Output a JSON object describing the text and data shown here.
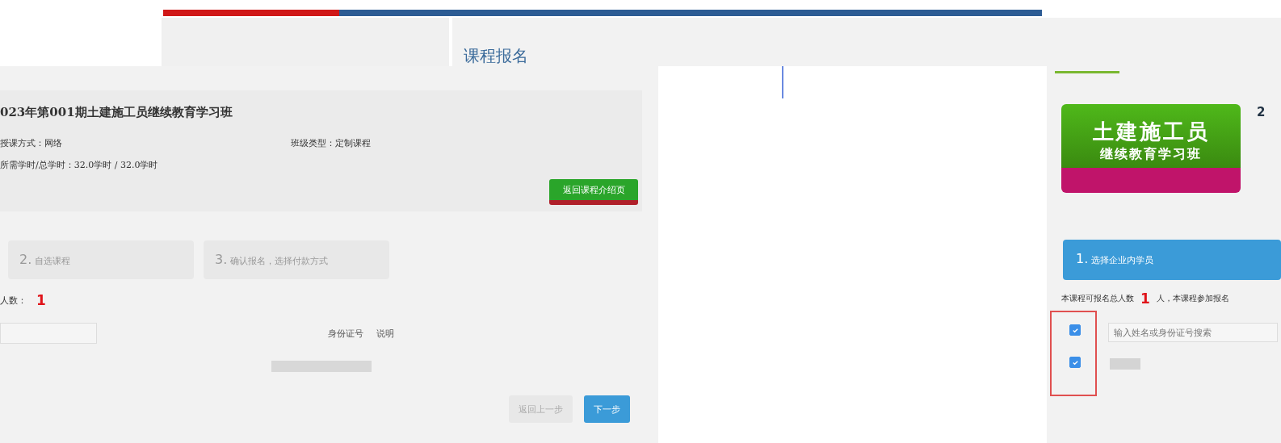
{
  "progress": {
    "level": 0.2
  },
  "page_title": "课程报名",
  "course_card": {
    "title": "023年第001期土建施工员继续教育学习班",
    "mode": "授课方式：网络",
    "class_type": "班级类型：定制课程",
    "hours": "所需学时/总学时：32.0学时 / 32.0学时",
    "button": "返回课程介绍页"
  },
  "steps_left": [
    {
      "number": "2.",
      "label": "自选课程",
      "selected": false
    },
    {
      "number": "3.",
      "label": "确认报名，选择付款方式",
      "selected": false
    }
  ],
  "count_left": {
    "label": "人数：",
    "value": "1"
  },
  "table_headers": [
    "身份证号",
    "说明"
  ],
  "buttons": [
    {
      "label": "返回上一步",
      "disabled": true
    },
    {
      "label": "下一步",
      "disabled": false
    }
  ],
  "right_panel": {
    "banner_line1": "土建施工员",
    "banner_line2": "继续教育学习班",
    "title_fragment": "2",
    "step": {
      "number": "1.",
      "label": "选择企业内学员",
      "selected": true
    },
    "count_prefix": "本课程可报名总人数",
    "count_value": "1",
    "count_suffix": "人，本课程参加报名",
    "search": {
      "placeholder": "输入姓名或身份证号搜索"
    },
    "checkboxes": [
      {
        "checked": true
      },
      {
        "checked": true
      }
    ]
  }
}
